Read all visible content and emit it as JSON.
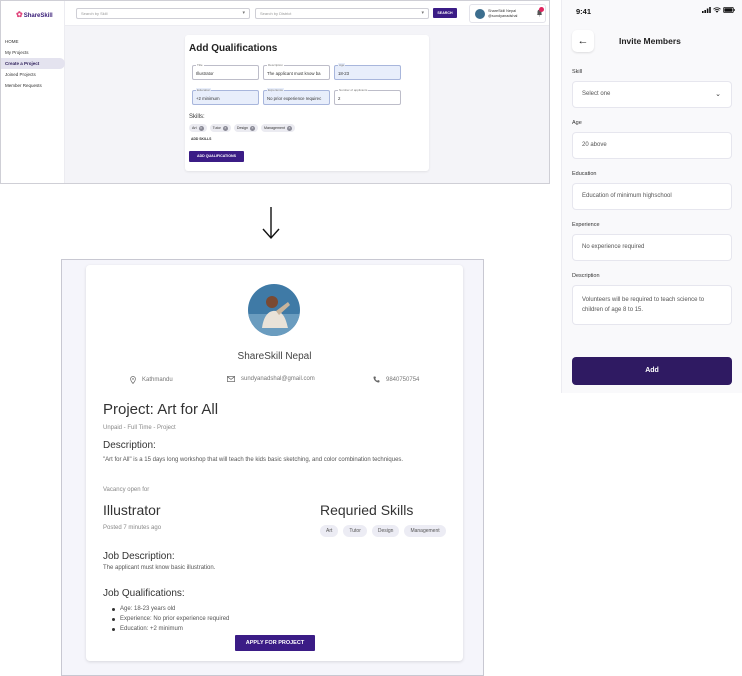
{
  "desktop": {
    "logo": "ShareSkill",
    "sidebar": {
      "items": [
        {
          "label": "HOME"
        },
        {
          "label": "My Projects"
        },
        {
          "label": "Create a Project"
        },
        {
          "label": "Joined Projects"
        },
        {
          "label": "Member Requests"
        }
      ]
    },
    "search": {
      "by_skill_placeholder": "Search by Skill",
      "by_district_placeholder": "Search by District",
      "button_label": "SEARCH"
    },
    "profile": {
      "name": "ShareSkill Nepal",
      "handle": "@sundyanadshal"
    },
    "form": {
      "title": "Add Qualifications",
      "fields": [
        {
          "label": "Title",
          "value": "Illustrator"
        },
        {
          "label": "Description",
          "value": "The applicant must know ba"
        },
        {
          "label": "Age",
          "value": "18-23"
        },
        {
          "label": "Education",
          "value": "+2 minimum"
        },
        {
          "label": "Experience",
          "value": "No prior experience requirec"
        },
        {
          "label": "Number of applicants",
          "value": "2"
        }
      ],
      "skills_label": "Skills:",
      "skills": [
        "Art",
        "Tutor",
        "Design",
        "Management"
      ],
      "add_skills_label": "ADD SKILLS",
      "submit_label": "ADD QUALIFICATIONS"
    }
  },
  "detail": {
    "org_name": "ShareSkill Nepal",
    "location": "Kathmandu",
    "email": "sundyanadshal@gmail.com",
    "phone": "9840750754",
    "project_title": "Project: Art for All",
    "project_meta": "Unpaid - Full Time - Project",
    "description_heading": "Description:",
    "description_text": "\"Art for All\" is a 15 days long workshop that will teach the kids basic sketching, and color combination techniques.",
    "vacancy_label": "Vacancy open for",
    "role": "Illustrator",
    "posted": "Posted 7 minutes ago",
    "required_skills_heading": "Requried Skills",
    "skills": [
      "Art",
      "Tutor",
      "Design",
      "Management"
    ],
    "job_description_heading": "Job Description:",
    "job_description_text": "The applicant must know basic illustration.",
    "job_qualifications_heading": "Job Qualifications:",
    "qualifications": [
      "Age: 18-23 years old",
      "Experience: No prior experience required",
      "Education: +2 minimum"
    ],
    "apply_label": "APPLY FOR PROJECT"
  },
  "mobile": {
    "time": "9:41",
    "title": "Invite Members",
    "skill_label": "Skill",
    "skill_placeholder": "Select one",
    "age_label": "Age",
    "age_value": "20 above",
    "education_label": "Education",
    "education_value": "Education of minimum highschool",
    "experience_label": "Experience",
    "experience_value": "No experience required",
    "description_label": "Description",
    "description_value": "Volunteers will be required to teach science to children of age 8 to 15.",
    "add_label": "Add"
  },
  "colors": {
    "brand_purple": "#3b1c86",
    "mobile_button": "#2f1a62",
    "notification_red": "#e0245e"
  },
  "icons": [
    "chevron-down-icon",
    "bell-icon",
    "location-pin-icon",
    "mail-icon",
    "phone-icon",
    "arrow-down-icon",
    "back-arrow-icon",
    "signal-icon",
    "wifi-icon",
    "battery-icon"
  ]
}
